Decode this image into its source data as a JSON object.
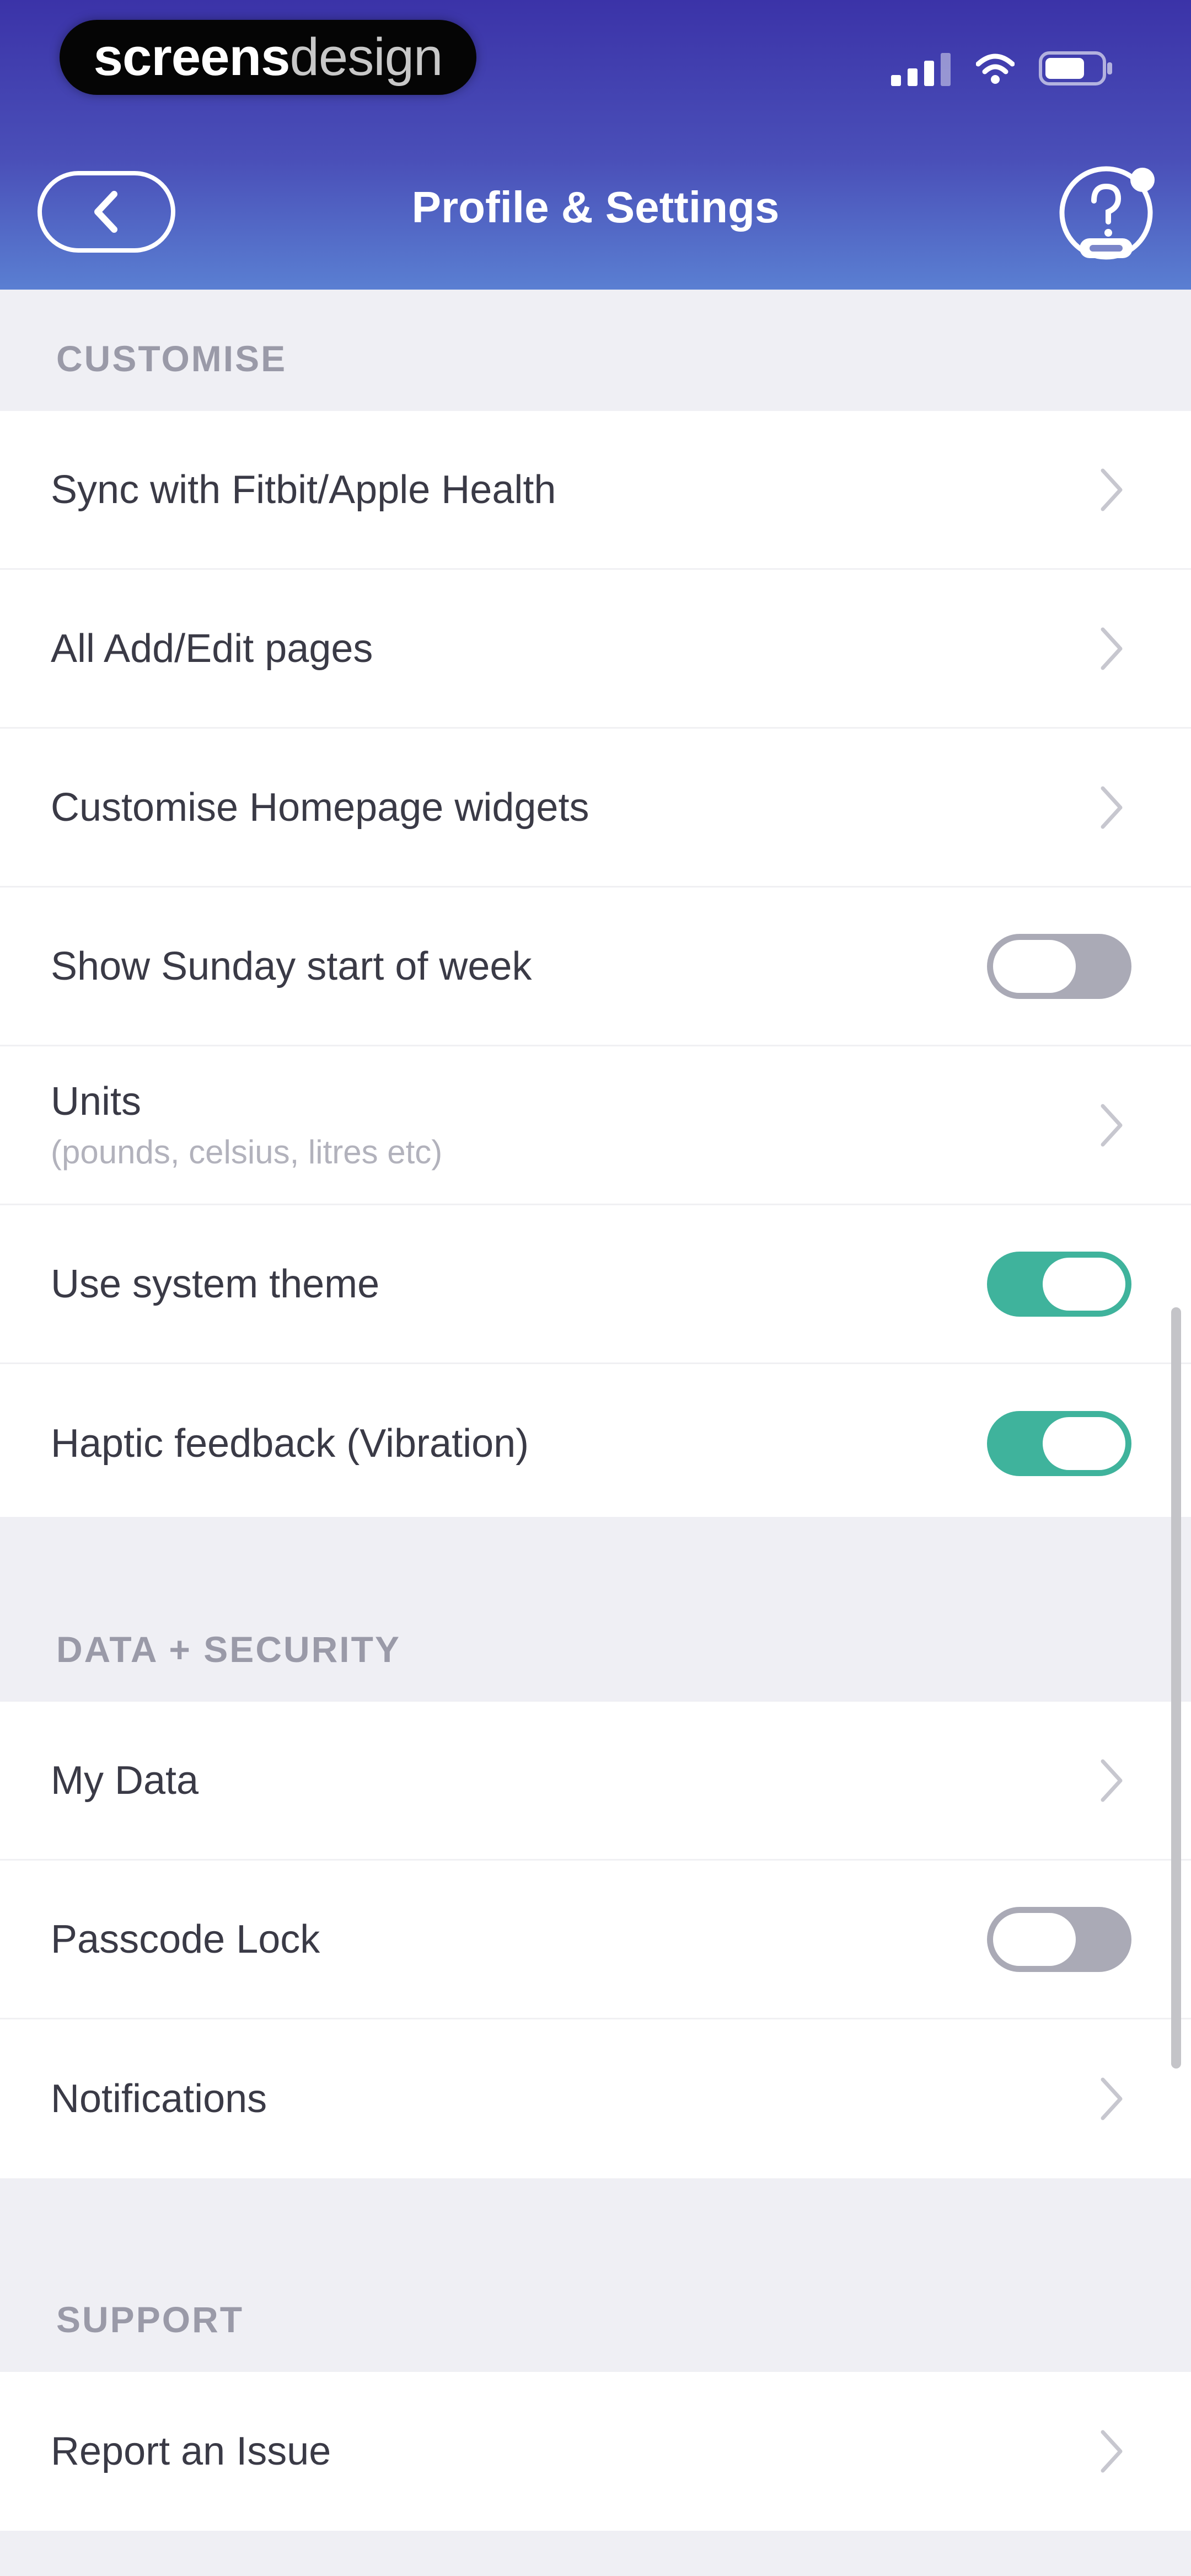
{
  "watermark": {
    "bold": "screens",
    "light": "design"
  },
  "nav": {
    "title": "Profile & Settings"
  },
  "colors": {
    "header_top": "#3b33a8",
    "header_bottom": "#5a7fd2",
    "toggle_on": "#3fb39c",
    "toggle_off": "#aaaab6",
    "section_background": "#efeff4"
  },
  "icons": {
    "back": "chevron-left-icon",
    "help": "question-help-icon",
    "row_arrow": "chevron-right-icon"
  },
  "sections": [
    {
      "title": "CUSTOMISE",
      "rows": [
        {
          "label": "Sync with Fitbit/Apple Health",
          "control": "chevron"
        },
        {
          "label": "All Add/Edit pages",
          "control": "chevron"
        },
        {
          "label": "Customise Homepage widgets",
          "control": "chevron"
        },
        {
          "label": "Show Sunday start of week",
          "control": "toggle",
          "on": false
        },
        {
          "label": "Units",
          "sublabel": "(pounds, celsius, litres etc)",
          "control": "chevron"
        },
        {
          "label": "Use system theme",
          "control": "toggle",
          "on": true
        },
        {
          "label": "Haptic feedback (Vibration)",
          "control": "toggle",
          "on": true
        }
      ]
    },
    {
      "title": "DATA + SECURITY",
      "rows": [
        {
          "label": "My Data",
          "control": "chevron"
        },
        {
          "label": "Passcode Lock",
          "control": "toggle",
          "on": false
        },
        {
          "label": "Notifications",
          "control": "chevron"
        }
      ]
    },
    {
      "title": "SUPPORT",
      "rows": [
        {
          "label": "Report an Issue",
          "control": "chevron"
        }
      ]
    }
  ]
}
